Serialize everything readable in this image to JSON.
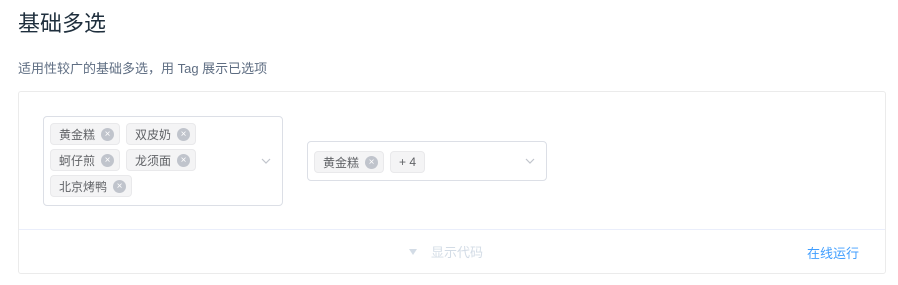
{
  "header": {
    "title": "基础多选",
    "description": "适用性较广的基础多选，用 Tag 展示已选项"
  },
  "select_basic": {
    "tags": [
      "黄金糕",
      "双皮奶",
      "蚵仔煎",
      "龙须面",
      "北京烤鸭"
    ],
    "arrow_icon": "chevron-down-icon"
  },
  "select_collapsed": {
    "tags": [
      "黄金糕"
    ],
    "collapsed_count": "+ 4",
    "arrow_icon": "chevron-down-icon"
  },
  "control": {
    "toggle_icon": "caret-down-icon",
    "show_code_label": "显示代码",
    "run_online_label": "在线运行"
  },
  "colors": {
    "accent": "#409eff",
    "tag_bg": "#f4f4f5",
    "border": "#dcdfe6"
  }
}
